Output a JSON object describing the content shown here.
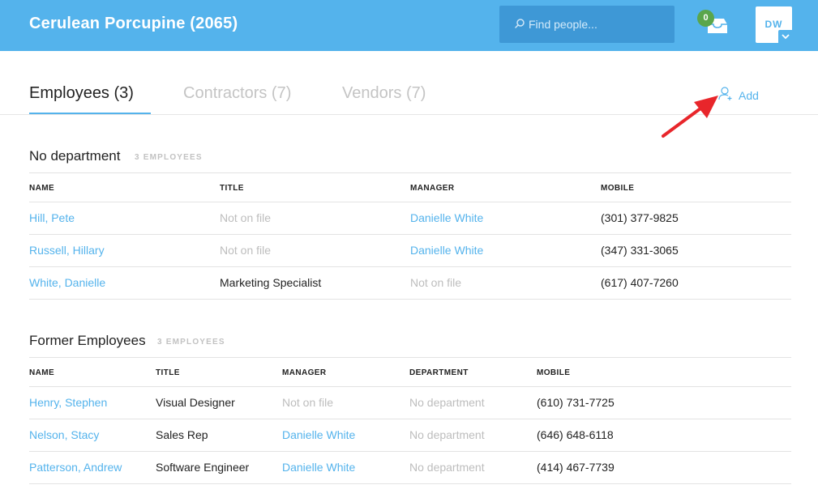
{
  "header": {
    "company": "Cerulean Porcupine (2065)",
    "search_placeholder": "Find people...",
    "inbox_count": "0",
    "user_initials": "DW"
  },
  "tabs": [
    {
      "label": "Employees (3)",
      "active": true
    },
    {
      "label": "Contractors (7)",
      "active": false
    },
    {
      "label": "Vendors (7)",
      "active": false
    }
  ],
  "add_label": "Add",
  "colors": {
    "accent": "#54b3ec",
    "header_bg": "#54b3ec",
    "search_bg": "#3e98d6",
    "badge": "#5aa64b",
    "arrow": "#e8262b"
  },
  "sections": [
    {
      "title": "No department",
      "count": "3 EMPLOYEES",
      "columns": [
        "NAME",
        "TITLE",
        "MANAGER",
        "MOBILE"
      ],
      "rows": [
        {
          "name": "Hill, Pete",
          "title": "Not on file",
          "manager": "Danielle White",
          "mobile": "(301) 377-9825"
        },
        {
          "name": "Russell, Hillary",
          "title": "Not on file",
          "manager": "Danielle White",
          "mobile": "(347) 331-3065"
        },
        {
          "name": "White, Danielle",
          "title": "Marketing Specialist",
          "manager": "Not on file",
          "mobile": "(617) 407-7260"
        }
      ]
    },
    {
      "title": "Former Employees",
      "count": "3 EMPLOYEES",
      "columns": [
        "NAME",
        "TITLE",
        "MANAGER",
        "DEPARTMENT",
        "MOBILE"
      ],
      "rows": [
        {
          "name": "Henry, Stephen",
          "title": "Visual Designer",
          "manager": "Not on file",
          "department": "No department",
          "mobile": "(610) 731-7725"
        },
        {
          "name": "Nelson, Stacy",
          "title": "Sales Rep",
          "manager": "Danielle White",
          "department": "No department",
          "mobile": "(646) 648-6118"
        },
        {
          "name": "Patterson, Andrew",
          "title": "Software Engineer",
          "manager": "Danielle White",
          "department": "No department",
          "mobile": "(414) 467-7739"
        }
      ]
    }
  ]
}
